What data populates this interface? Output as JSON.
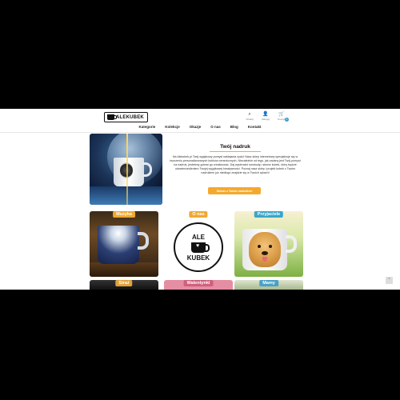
{
  "header": {
    "logo_text": "ALEKUBEK",
    "icons": [
      {
        "name": "search-icon",
        "glyph": "⌕",
        "label": "Szukaj"
      },
      {
        "name": "user-icon",
        "glyph": "👤",
        "label": "Zaloguj"
      },
      {
        "name": "cart-icon",
        "glyph": "🛒",
        "label": "Koszyk",
        "badge": "0"
      }
    ]
  },
  "nav": {
    "items": [
      "Kategorie",
      "Kolekcje",
      "Okazje",
      "O nas",
      "Blog",
      "Kontakt"
    ]
  },
  "intro": {
    "title": "Twój nadruk",
    "text": "Na Alekubek.pl Twój wyjątkowy pomysł naklejania życiu! Nasz sklep internetowy specjalizuje się w tworzeniu personalizowanych kubków ceramicznych. Niezależnie od tego, jak zadany jest Twój pomysł na nadruk, jesteśmy gotowi go zrealizować. Daj wyobraźni swobodę i stwórz kubek, który będzie odzwierciedleniem Twojej wyjątkowej kreatywności. Poznaj nasz sklep i projekt kubek z Twoim nadrukiem już niedługo znajdzie się w Twoich rękach!",
    "button": "Stwórz z Twoim nadrukiem"
  },
  "tiles": {
    "muzyka": "Muzyka",
    "onas": "O nas",
    "onas_logo_top": "ALE",
    "onas_logo_bottom": "KUBEK",
    "przyjaciele": "Przyjaciele",
    "straz": "Straż",
    "walentynki": "Walentynki",
    "mamy": "Mamy"
  },
  "colors": {
    "accent": "#f4a92d",
    "blue": "#3aa6c9",
    "pink": "#e58da3"
  }
}
